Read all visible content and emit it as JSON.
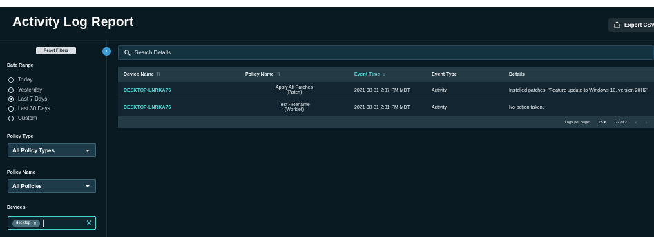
{
  "header": {
    "title": "Activity Log Report",
    "export_label": "Export CSV"
  },
  "sidebar": {
    "reset_label": "Reset Filters",
    "date_range": {
      "label": "Date Range",
      "options": [
        "Today",
        "Yesterday",
        "Last 7 Days",
        "Last 30 Days",
        "Custom"
      ],
      "selected": "Last 7 Days"
    },
    "policy_type": {
      "label": "Policy Type",
      "value": "All Policy Types"
    },
    "policy_name": {
      "label": "Policy Name",
      "value": "All Policies"
    },
    "devices": {
      "label": "Devices",
      "chip": "desktop"
    }
  },
  "search": {
    "placeholder": "Search Details"
  },
  "table": {
    "columns": [
      "Device Name",
      "Policy Name",
      "Event Time",
      "Event Type",
      "Details"
    ],
    "rows": [
      {
        "device": "DESKTOP-LNRKA76",
        "policy": "Apply All Patches",
        "policy_sub": "(Patch)",
        "time": "2021-08-31 2:37 PM MDT",
        "type": "Activity",
        "details": "Installed patches: \"Feature update to Windows 10, version 20H2\""
      },
      {
        "device": "DESKTOP-LNRKA76",
        "policy": "Test - Rename",
        "policy_sub": "(Worklet)",
        "time": "2021-08-31 2:31 PM MDT",
        "type": "Activity",
        "details": "No action taken."
      }
    ],
    "pager": {
      "label": "Logs per page:",
      "per_page": "25",
      "range": "1-2 of 2"
    }
  },
  "colors": {
    "background": "#0a1a22",
    "accent": "#4fd3d3",
    "toggle": "#3a9bd5"
  }
}
